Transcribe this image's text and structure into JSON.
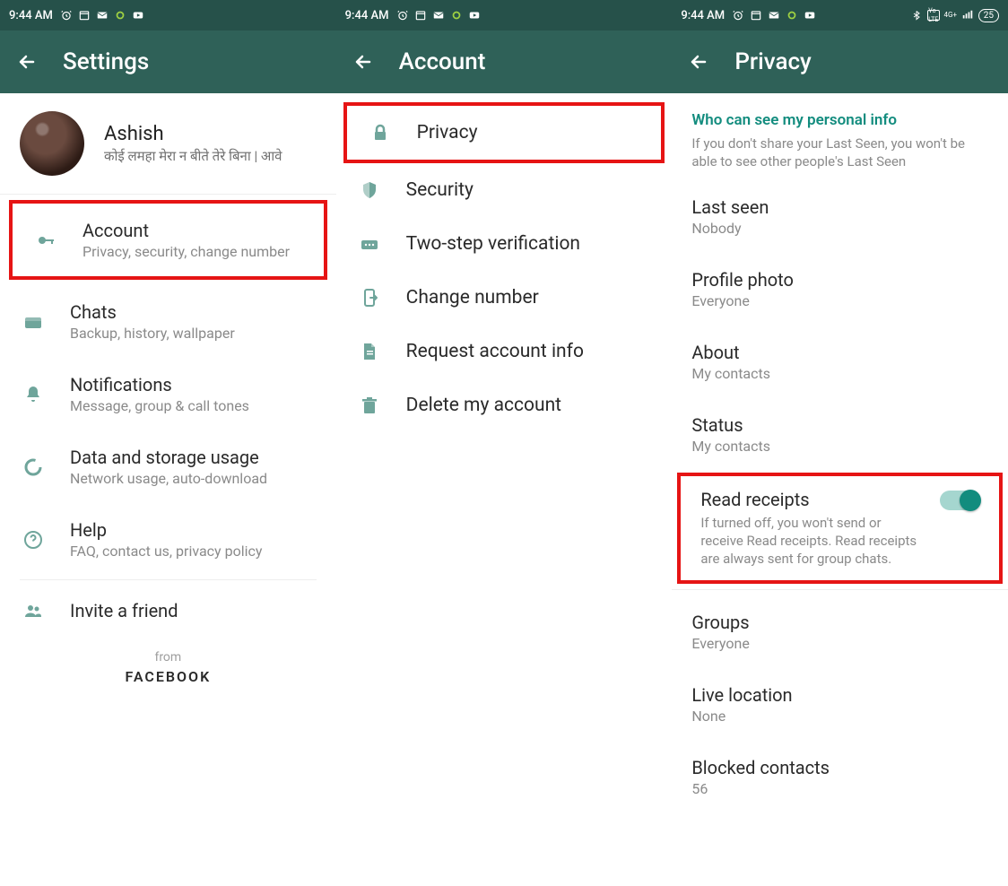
{
  "status": {
    "time": "9:44 AM",
    "battery": "25"
  },
  "panel1": {
    "title": "Settings",
    "profile": {
      "name": "Ashish",
      "status": "कोई लमहा मेरा न बीते तेरे बिना | आवे"
    },
    "items": [
      {
        "title": "Account",
        "sub": "Privacy, security, change number"
      },
      {
        "title": "Chats",
        "sub": "Backup, history, wallpaper"
      },
      {
        "title": "Notifications",
        "sub": "Message, group & call tones"
      },
      {
        "title": "Data and storage usage",
        "sub": "Network usage, auto-download"
      },
      {
        "title": "Help",
        "sub": "FAQ, contact us, privacy policy"
      },
      {
        "title": "Invite a friend",
        "sub": ""
      }
    ],
    "from": "from",
    "facebook": "FACEBOOK"
  },
  "panel2": {
    "title": "Account",
    "items": [
      {
        "title": "Privacy"
      },
      {
        "title": "Security"
      },
      {
        "title": "Two-step verification"
      },
      {
        "title": "Change number"
      },
      {
        "title": "Request account info"
      },
      {
        "title": "Delete my account"
      }
    ]
  },
  "panel3": {
    "title": "Privacy",
    "section_head": "Who can see my personal info",
    "section_desc": "If you don't share your Last Seen, you won't be able to see other people's Last Seen",
    "items": [
      {
        "title": "Last seen",
        "sub": "Nobody"
      },
      {
        "title": "Profile photo",
        "sub": "Everyone"
      },
      {
        "title": "About",
        "sub": "My contacts"
      },
      {
        "title": "Status",
        "sub": "My contacts"
      }
    ],
    "read_receipts": {
      "title": "Read receipts",
      "desc": "If turned off, you won't send or receive Read receipts. Read receipts are always sent for group chats.",
      "on": true
    },
    "after": [
      {
        "title": "Groups",
        "sub": "Everyone"
      },
      {
        "title": "Live location",
        "sub": "None"
      },
      {
        "title": "Blocked contacts",
        "sub": "56"
      }
    ]
  }
}
